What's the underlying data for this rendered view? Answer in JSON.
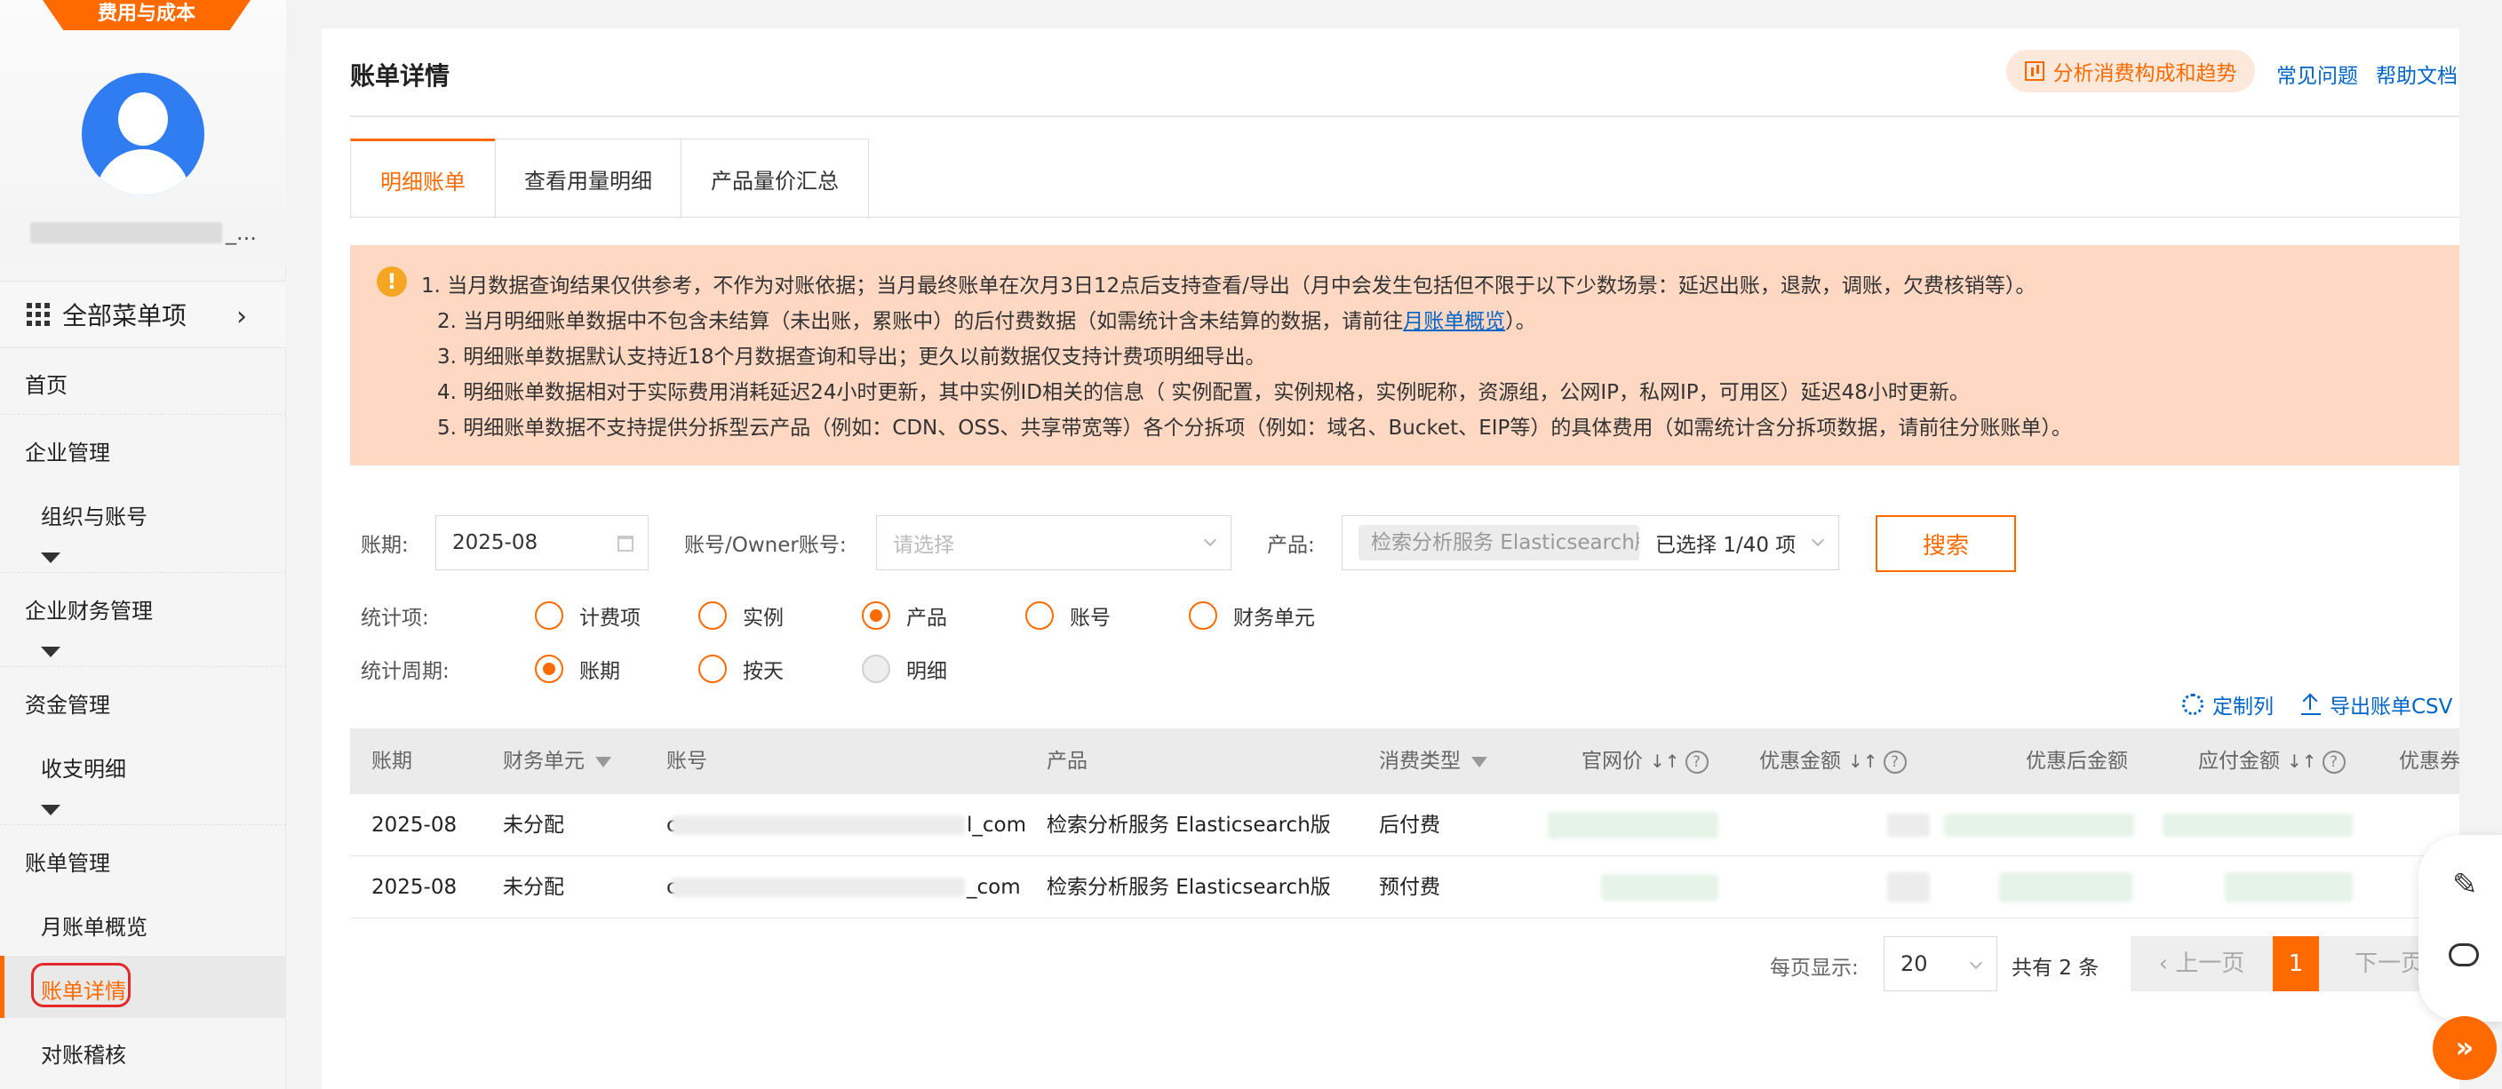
{
  "sidebar": {
    "brand": "费用与成本",
    "username_suffix": "_...",
    "all_menu": "全部菜单项",
    "items": [
      {
        "label": "首页"
      },
      {
        "label": "企业管理"
      },
      {
        "label": "组织与账号"
      },
      {
        "label": "企业财务管理"
      },
      {
        "label": "资金管理"
      },
      {
        "label": "收支明细"
      },
      {
        "label": "账单管理"
      },
      {
        "label": "月账单概览"
      },
      {
        "label": "账单详情"
      },
      {
        "label": "对账稽核"
      }
    ],
    "active_item": "账单详情",
    "icons": {
      "menu": "grid-icon",
      "expand": "chevron-right-icon",
      "collapse": "caret-down-icon"
    }
  },
  "header": {
    "title": "账单详情",
    "analyze_button": "分析消费构成和趋势",
    "faq_link": "常见问题",
    "help_link": "帮助文档"
  },
  "tabs": [
    {
      "label": "明细账单",
      "active": true
    },
    {
      "label": "查看用量明细",
      "active": false
    },
    {
      "label": "产品量价汇总",
      "active": false
    }
  ],
  "notice": {
    "icon": "!",
    "line1": "1. 当月数据查询结果仅供参考，不作为对账依据；当月最终账单在次月3日12点后支持查看/导出（月中会发生包括但不限于以下少数场景：延迟出账，退款，调账，欠费核销等）。",
    "line2_prefix": "2. 当月明细账单数据中不包含未结算（未出账，累账中）的后付费数据（如需统计含未结算的数据，请前往",
    "line2_link": "月账单概览",
    "line2_suffix": "）。",
    "line3": "3. 明细账单数据默认支持近18个月数据查询和导出；更久以前数据仅支持计费项明细导出。",
    "line4": "4. 明细账单数据相对于实际费用消耗延迟24小时更新，其中实例ID相关的信息（ 实例配置，实例规格，实例昵称，资源组，公网IP，私网IP，可用区）延迟48小时更新。",
    "line5": "5. 明细账单数据不支持提供分拆型云产品（例如：CDN、OSS、共享带宽等）各个分拆项（例如：域名、Bucket、EIP等）的具体费用（如需统计含分拆项数据，请前往分账账单）。"
  },
  "filters": {
    "period_label": "账期:",
    "period_value": "2025-08",
    "account_label": "账号/Owner账号:",
    "account_placeholder": "请选择",
    "product_label": "产品:",
    "product_tag": "检索分析服务 Elasticsearch版",
    "product_count": "已选择 1/40 项",
    "search_button": "搜索",
    "stat_item_label": "统计项:",
    "stat_items": [
      {
        "label": "计费项",
        "selected": false
      },
      {
        "label": "实例",
        "selected": false
      },
      {
        "label": "产品",
        "selected": true
      },
      {
        "label": "账号",
        "selected": false
      },
      {
        "label": "财务单元",
        "selected": false
      }
    ],
    "stat_period_label": "统计周期:",
    "stat_periods": [
      {
        "label": "账期",
        "selected": true
      },
      {
        "label": "按天",
        "selected": false
      },
      {
        "label": "明细",
        "selected": false,
        "disabled": true
      }
    ]
  },
  "toolbar": {
    "custom_columns": "定制列",
    "export_csv": "导出账单CSV"
  },
  "table": {
    "columns": [
      "账期",
      "财务单元",
      "账号",
      "产品",
      "消费类型",
      "官网价",
      "优惠金额",
      "优惠后金额",
      "应付金额",
      "优惠券"
    ],
    "rows": [
      {
        "period": "2025-08",
        "unit": "未分配",
        "account_prefix": "c",
        "account_suffix": "l_com",
        "product": "检索分析服务 Elasticsearch版",
        "type": "后付费"
      },
      {
        "period": "2025-08",
        "unit": "未分配",
        "account_prefix": "c",
        "account_suffix": "_com",
        "product": "检索分析服务 Elasticsearch版",
        "type": "预付费"
      }
    ]
  },
  "pagination": {
    "per_page_label": "每页显示:",
    "per_page": "20",
    "total": "共有 2 条",
    "prev": "上一页",
    "current": "1",
    "next": "下一页"
  },
  "colors": {
    "accent": "#ff6a00",
    "link": "#0064c8",
    "notice_bg": "#fed8c2"
  }
}
